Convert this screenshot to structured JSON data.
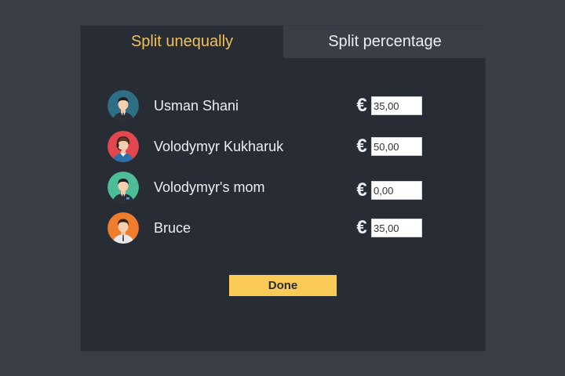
{
  "tabs": {
    "active": "Split unequally",
    "inactive": "Split percentage"
  },
  "currency_symbol": "€",
  "people": [
    {
      "name": "Usman Shani",
      "amount": "35,00",
      "avatar_color": "#2f6f86",
      "icon": "user-avatar-icon"
    },
    {
      "name": "Volodymyr Kukharuk",
      "amount": "50,00",
      "avatar_color": "#e2474d",
      "icon": "user-avatar-icon"
    },
    {
      "name": "Volodymyr's mom",
      "amount": "0,00",
      "avatar_color": "#4dbd97",
      "icon": "user-avatar-icon"
    },
    {
      "name": "Bruce",
      "amount": "35,00",
      "avatar_color": "#f07d2b",
      "icon": "user-avatar-icon"
    }
  ],
  "done_label": "Done",
  "colors": {
    "accent": "#f0c05a",
    "button": "#fbcb58",
    "panel": "#282d35",
    "background": "#3a3f47"
  }
}
